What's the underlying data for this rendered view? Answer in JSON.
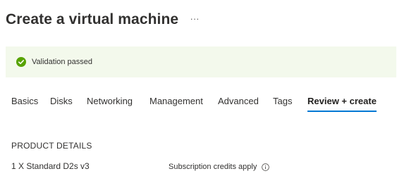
{
  "header": {
    "title": "Create a virtual machine",
    "more_label": "···"
  },
  "validation": {
    "message": "Validation passed",
    "status_color": "#57a300",
    "icon": "checkmark-circle-icon"
  },
  "tabs": [
    {
      "label": "Basics",
      "active": false
    },
    {
      "label": "Disks",
      "active": false
    },
    {
      "label": "Networking",
      "active": false
    },
    {
      "label": "Management",
      "active": false
    },
    {
      "label": "Advanced",
      "active": false
    },
    {
      "label": "Tags",
      "active": false
    },
    {
      "label": "Review + create",
      "active": true
    }
  ],
  "accent_color": "#0078d4",
  "product": {
    "section_title": "PRODUCT DETAILS",
    "name": "1 X Standard D2s v3",
    "credits_text": "Subscription credits apply",
    "info_icon": "info-icon"
  }
}
